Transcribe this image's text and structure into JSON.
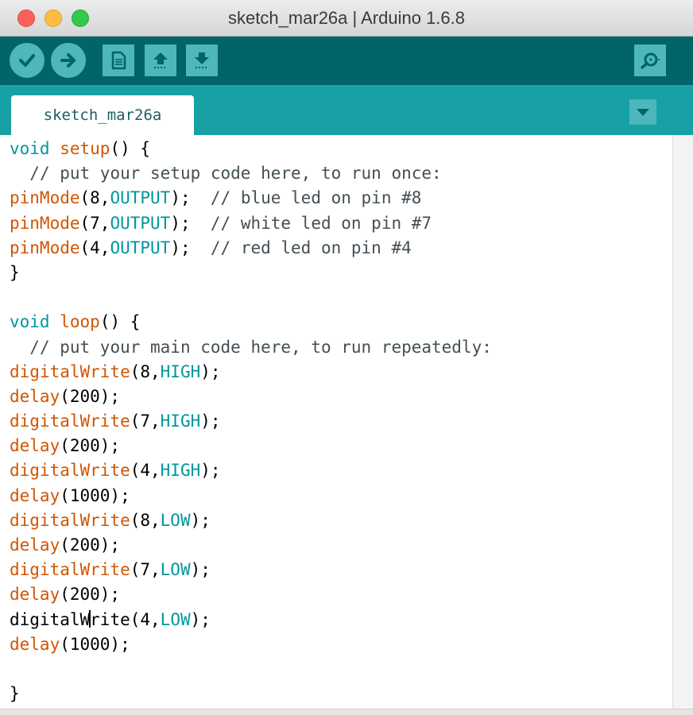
{
  "window": {
    "title": "sketch_mar26a | Arduino 1.6.8"
  },
  "toolbar": {
    "buttons": [
      {
        "name": "verify",
        "icon": "checkmark-icon"
      },
      {
        "name": "upload",
        "icon": "arrow-right-icon"
      },
      {
        "name": "new",
        "icon": "new-document-icon"
      },
      {
        "name": "open",
        "icon": "arrow-up-icon"
      },
      {
        "name": "save",
        "icon": "arrow-down-icon"
      },
      {
        "name": "serial-monitor",
        "icon": "magnifier-icon"
      }
    ]
  },
  "tabs": [
    {
      "label": "sketch_mar26a",
      "active": true
    }
  ],
  "editor": {
    "lines": [
      "void setup() {",
      "  // put your setup code here, to run once:",
      "pinMode(8,OUTPUT);  // blue led on pin #8",
      "pinMode(7,OUTPUT);  // white led on pin #7",
      "pinMode(4,OUTPUT);  // red led on pin #4",
      "}",
      "",
      "void loop() {",
      "  // put your main code here, to run repeatedly:",
      "digitalWrite(8,HIGH);",
      "delay(200);",
      "digitalWrite(7,HIGH);",
      "delay(200);",
      "digitalWrite(4,HIGH);",
      "delay(1000);",
      "digitalWrite(8,LOW);",
      "delay(200);",
      "digitalWrite(7,LOW);",
      "delay(200);",
      "digitalWrite(4,LOW);",
      "delay(1000);",
      "",
      "}"
    ],
    "cursor": {
      "line": 19,
      "column": 8
    }
  },
  "colors": {
    "toolbar": "#006468",
    "tabbar": "#17a1a5",
    "button": "#4db7bb",
    "keyword": "#00979c",
    "function": "#d35400",
    "comment": "#434f54"
  }
}
